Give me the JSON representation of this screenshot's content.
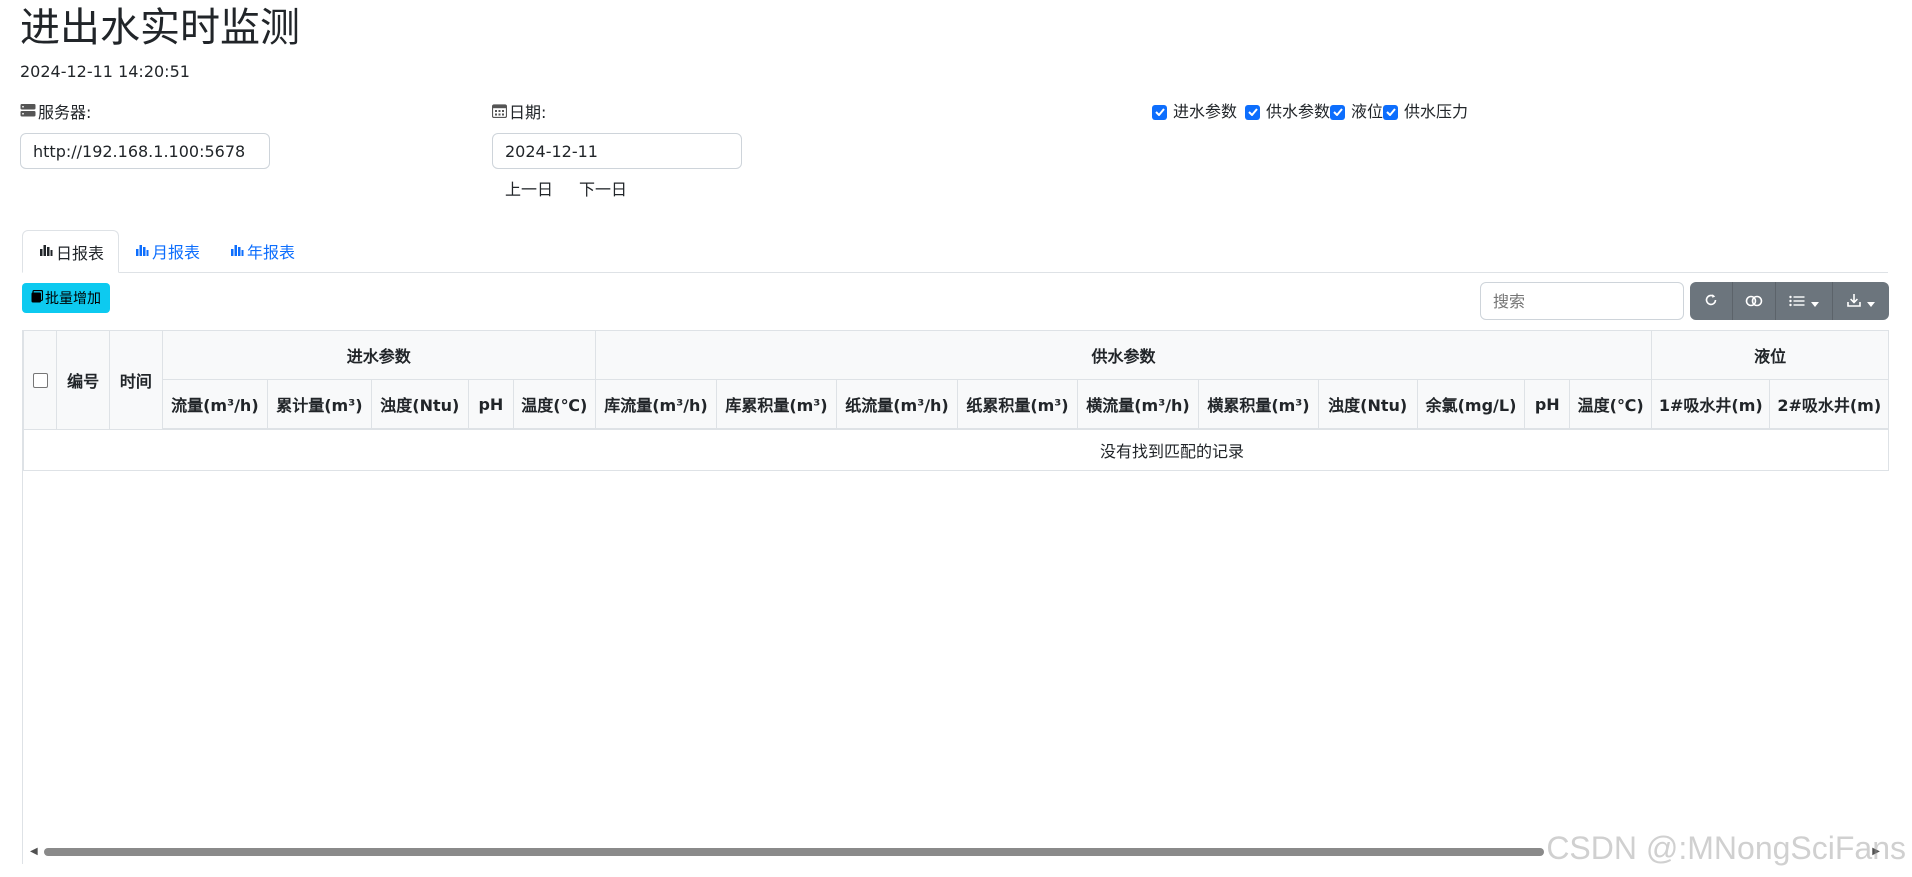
{
  "page": {
    "title": "进出水实时监测",
    "datetime": "2024-12-11 14:20:51"
  },
  "server": {
    "label": "服务器:",
    "value": "http://192.168.1.100:5678",
    "icon": "server-icon"
  },
  "date": {
    "label": "日期:",
    "value": "2024-12-11",
    "icon": "calendar-icon",
    "prev_label": "上一日",
    "next_label": "下一日"
  },
  "filters": [
    {
      "label": "进水参数",
      "checked": true
    },
    {
      "label": "供水参数",
      "checked": true
    },
    {
      "label": "液位",
      "checked": true
    },
    {
      "label": "供水压力",
      "checked": true
    }
  ],
  "tabs": [
    {
      "label": "日报表",
      "active": true,
      "icon": "bar-chart-icon"
    },
    {
      "label": "月报表",
      "active": false,
      "icon": "bar-chart-icon"
    },
    {
      "label": "年报表",
      "active": false,
      "icon": "bar-chart-icon"
    }
  ],
  "toolbar": {
    "bulk_add_label": "批量增加",
    "search_placeholder": "搜索",
    "icons": [
      "refresh-icon",
      "toggle-icon",
      "columns-list-icon",
      "export-download-icon"
    ]
  },
  "table": {
    "fixed_headers": [
      "编号",
      "时间"
    ],
    "groups": [
      {
        "label": "进水参数",
        "columns": [
          "流量(m³/h)",
          "累计量(m³)",
          "浊度(Ntu)",
          "pH",
          "温度(℃)"
        ]
      },
      {
        "label": "供水参数",
        "columns": [
          "库流量(m³/h)",
          "库累积量(m³)",
          "纸流量(m³/h)",
          "纸累积量(m³)",
          "横流量(m³/h)",
          "横累积量(m³)",
          "浊度(Ntu)",
          "余氯(mg/L)",
          "pH",
          "温度(℃)"
        ]
      },
      {
        "label": "液位",
        "columns": [
          "1#吸水井(m)",
          "2#吸水井(m)"
        ]
      }
    ],
    "empty_message": "没有找到匹配的记录"
  },
  "colors": {
    "primary": "#0d6efd",
    "info": "#0dcaf0",
    "secondary": "#6c757d",
    "border": "#dee2e6"
  },
  "watermark": "CSDN @:MNongSciFans"
}
